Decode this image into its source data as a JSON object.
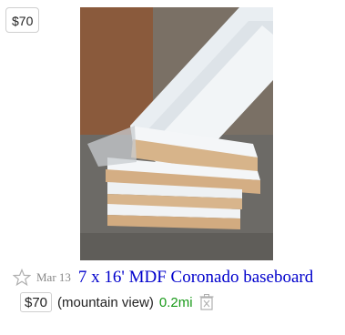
{
  "listing": {
    "price_overlay": "$70",
    "date": "Mar 13",
    "title": "7 x 16' MDF Coronado baseboard",
    "price": "$70",
    "hood": "(mountain view)",
    "distance": "0.2mi",
    "image_alt": "stack of white MDF baseboard boards"
  },
  "icons": {
    "favorite": "star-outline-icon",
    "hide": "trash-hide-icon"
  },
  "colors": {
    "title_link": "#0000cc",
    "distance": "#1a9a1a",
    "date": "#888888"
  }
}
